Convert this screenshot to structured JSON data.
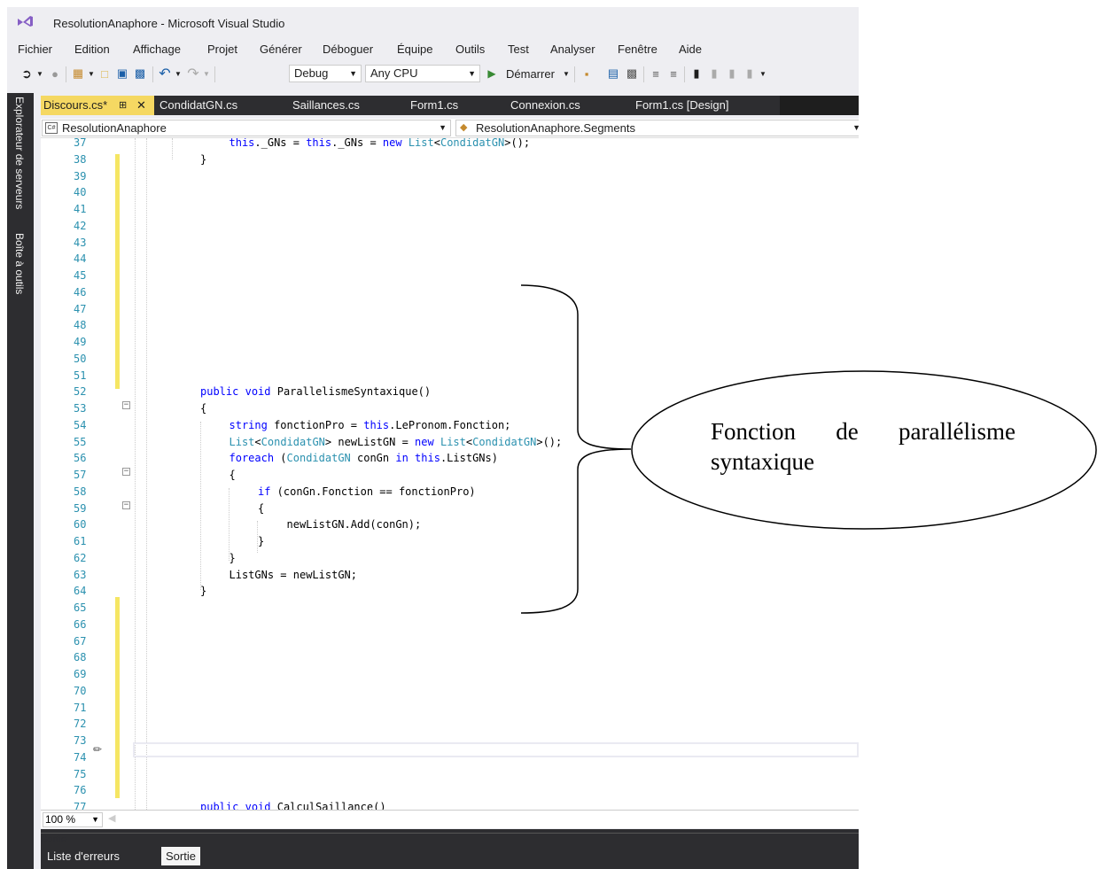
{
  "window": {
    "title": "ResolutionAnaphore - Microsoft Visual Studio"
  },
  "menu": [
    "Fichier",
    "Edition",
    "Affichage",
    "Projet",
    "Générer",
    "Déboguer",
    "Équipe",
    "Outils",
    "Test",
    "Analyser",
    "Fenêtre",
    "Aide"
  ],
  "toolbar": {
    "config": "Debug",
    "platform": "Any CPU",
    "start_label": "Démarrer"
  },
  "sidebar": {
    "server_explorer": "Explorateur de serveurs",
    "toolbox": "Boîte à outils"
  },
  "tabs": [
    {
      "label": "Discours.cs*",
      "active": true
    },
    {
      "label": "CondidatGN.cs"
    },
    {
      "label": "Saillances.cs"
    },
    {
      "label": "Form1.cs"
    },
    {
      "label": "Connexion.cs"
    },
    {
      "label": "Form1.cs [Design]"
    }
  ],
  "nav": {
    "project": "ResolutionAnaphore",
    "scope": "ResolutionAnaphore.Segments"
  },
  "editor": {
    "lines": [
      {
        "n": "37",
        "t": "this._GNs = this._GNs = new List<CondidatGN>();"
      },
      {
        "n": "38",
        "t": "}"
      },
      {
        "n": "39",
        "t": ""
      },
      {
        "n": "40",
        "t": ""
      },
      {
        "n": "41",
        "t": ""
      },
      {
        "n": "42",
        "t": ""
      },
      {
        "n": "43",
        "t": ""
      },
      {
        "n": "44",
        "t": ""
      },
      {
        "n": "45",
        "t": ""
      },
      {
        "n": "46",
        "t": ""
      },
      {
        "n": "47",
        "t": ""
      },
      {
        "n": "48",
        "t": ""
      },
      {
        "n": "49",
        "t": ""
      },
      {
        "n": "50",
        "t": ""
      },
      {
        "n": "51",
        "t": ""
      },
      {
        "n": "52",
        "t": "public void ParallelismeSyntaxique()"
      },
      {
        "n": "53",
        "t": "{"
      },
      {
        "n": "54",
        "t": "string fonctionPro = this.LePronom.Fonction;"
      },
      {
        "n": "55",
        "t": "List<CondidatGN> newListGN = new List<CondidatGN>();"
      },
      {
        "n": "56",
        "t": "foreach (CondidatGN conGn in this.ListGNs)"
      },
      {
        "n": "57",
        "t": "{"
      },
      {
        "n": "58",
        "t": "if (conGn.Fonction == fonctionPro)"
      },
      {
        "n": "59",
        "t": "{"
      },
      {
        "n": "60",
        "t": "newListGN.Add(conGn);"
      },
      {
        "n": "61",
        "t": "}"
      },
      {
        "n": "62",
        "t": "}"
      },
      {
        "n": "63",
        "t": "ListGNs = newListGN;"
      },
      {
        "n": "64",
        "t": "}"
      },
      {
        "n": "65",
        "t": ""
      },
      {
        "n": "66",
        "t": ""
      },
      {
        "n": "67",
        "t": ""
      },
      {
        "n": "68",
        "t": ""
      },
      {
        "n": "69",
        "t": ""
      },
      {
        "n": "70",
        "t": ""
      },
      {
        "n": "71",
        "t": ""
      },
      {
        "n": "72",
        "t": ""
      },
      {
        "n": "73",
        "t": ""
      },
      {
        "n": "74",
        "t": ""
      },
      {
        "n": "75",
        "t": ""
      },
      {
        "n": "76",
        "t": ""
      },
      {
        "n": "77",
        "t": "public void CalculSaillance()"
      }
    ]
  },
  "status": {
    "zoom": "100 %"
  },
  "output_panel": {
    "title": "Sortie",
    "tabs": [
      "Liste d'erreurs",
      "Sortie"
    ]
  },
  "annotation": {
    "text": "Fonction de parallélisme syntaxique"
  },
  "colors": {
    "tab_active": "#f5d862",
    "dark": "#2d2d30",
    "keyword": "#0000ff",
    "type": "#2b91af",
    "line_number": "#2b91af",
    "change_bar": "#f5e663"
  }
}
